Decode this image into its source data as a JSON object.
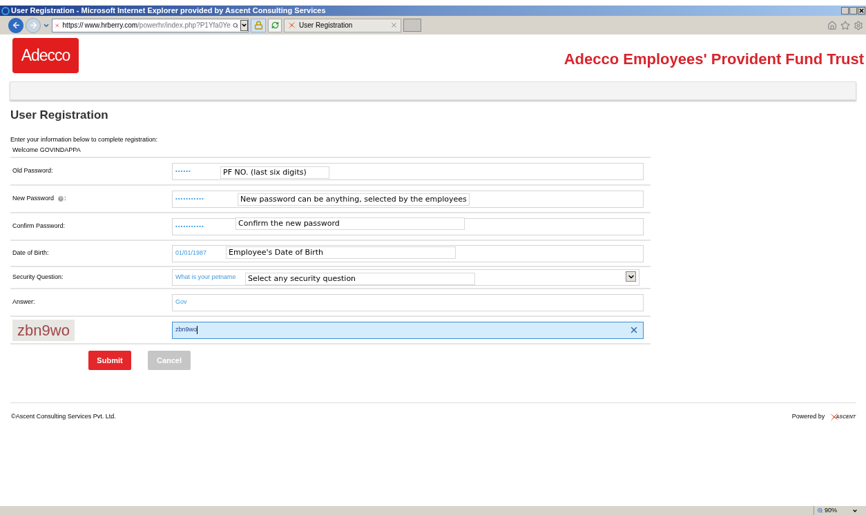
{
  "window": {
    "title": "User Registration - Microsoft Internet Explorer provided by Ascent Consulting Services"
  },
  "browser": {
    "url_prefix": "https://",
    "url_domain": "www.hrberry.com",
    "url_path": "/powerhr/index.php?P1Yfa0Ye",
    "tab_title": "User Registration",
    "zoom": "90%"
  },
  "header": {
    "logo": "Adecco",
    "org_title": "Adecco Employees' Provident Fund Trust"
  },
  "page": {
    "heading": "User Registration",
    "intro": "Enter your information below to complete registration:",
    "welcome": "Welcome GOVINDAPPA"
  },
  "fields": [
    {
      "kind": "password",
      "label": "Old Password:",
      "value": "••••••",
      "note": "PF NO. (last six digits)",
      "focused": false
    },
    {
      "kind": "password",
      "label": "New Password",
      "value": "•••••••••••",
      "note": "New password can be anything, selected by the employees",
      "help": true,
      "label_suffix": ":",
      "focused": false
    },
    {
      "kind": "password",
      "label": "Confirm Password:",
      "value": "•••••••••••",
      "note": "Confirm the new password",
      "focused": false
    },
    {
      "kind": "text",
      "label": "Date of Birth:",
      "value": "01/01/1987",
      "note": "Employee's Date of Birth",
      "focused": false
    },
    {
      "kind": "select",
      "label": "Security Question:",
      "value": "What is your petname",
      "note": "Select any security question"
    },
    {
      "kind": "text",
      "label": "Answer:",
      "value": "Gov",
      "focused": false
    },
    {
      "kind": "captcha",
      "captcha": "zbn9wo",
      "value": "zbn9wo",
      "focused": true
    }
  ],
  "buttons": [
    {
      "label": "Submit",
      "disabled": false
    },
    {
      "label": "Cancel",
      "disabled": true
    }
  ],
  "footer": {
    "copyright": "©Ascent Consulting Services Pvt. Ltd.",
    "powered_by": "Powered by",
    "brand": "ASCENT"
  }
}
